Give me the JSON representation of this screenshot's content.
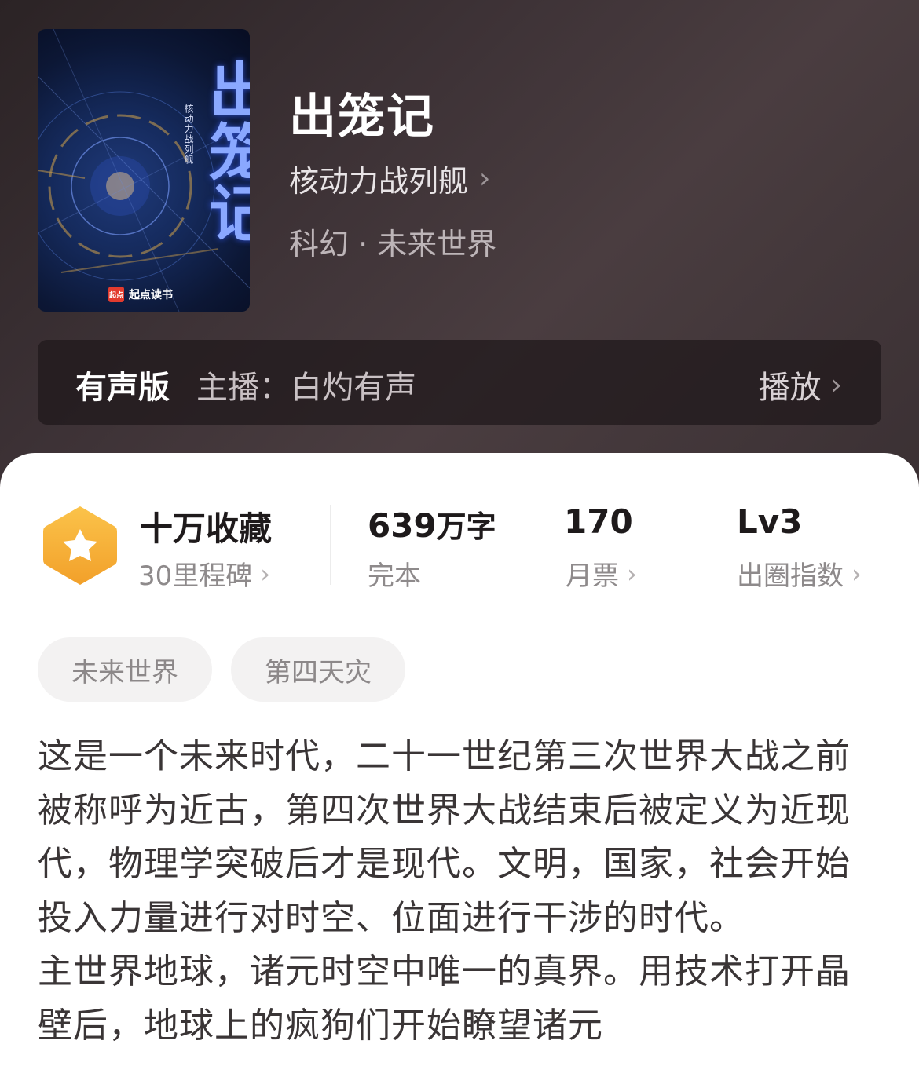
{
  "book": {
    "title": "出笼记",
    "author": "核动力战列舰",
    "genre": "科幻 · 未来世界",
    "cover": {
      "title": "出笼记",
      "subtitle": "核动力战列舰",
      "brand": "起点读书",
      "brand_mark": "起点"
    }
  },
  "audio": {
    "label": "有声版",
    "host": "主播：白灼有声",
    "action": "播放"
  },
  "stats": [
    {
      "value": "十万收藏",
      "label": "30里程碑",
      "has_arrow": true
    },
    {
      "value": "639",
      "unit": "万字",
      "label": "完本",
      "has_arrow": false
    },
    {
      "value": "170",
      "label": "月票",
      "has_arrow": true
    },
    {
      "value": "Lv3",
      "label": "出圈指数",
      "has_arrow": true
    }
  ],
  "tags": [
    "未来世界",
    "第四天灾"
  ],
  "synopsis": [
    "这是一个未来时代，二十一世纪第三次世界大战之前被称呼为近古，第四次世界大战结束后被定义为近现代，物理学突破后才是现代。文明，国家，社会开始投入力量进行对时空、位面进行干涉的时代。",
    "主世界地球，诸元时空中唯一的真界。用技术打开晶壁后，地球上的疯狗们开始瞭望诸元"
  ],
  "colors": {
    "hero_bg": "#3d3236",
    "badge": "#f7b137",
    "text_primary": "#1e1a1b",
    "text_secondary": "#8e8a8b"
  },
  "icons": {
    "arrow": "chevron-right-icon",
    "badge": "star-hexagon-icon"
  }
}
